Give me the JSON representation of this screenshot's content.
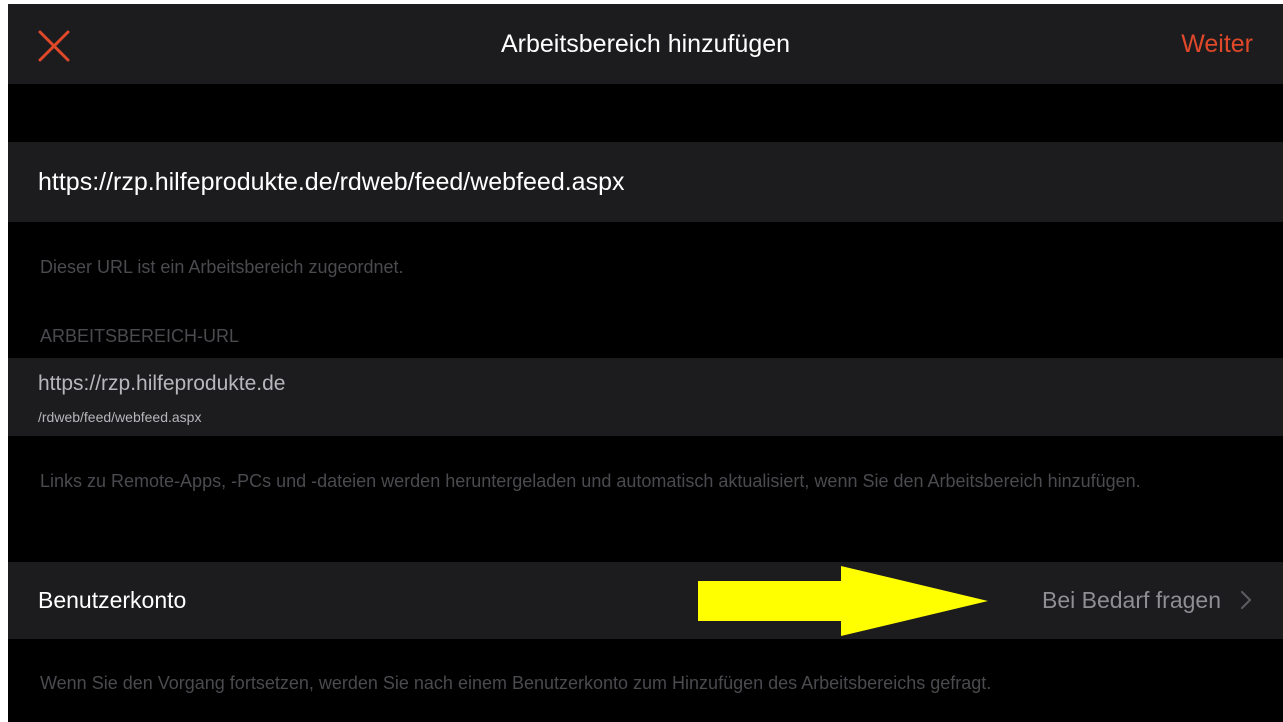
{
  "nav": {
    "title": "Arbeitsbereich hinzufügen",
    "next_label": "Weiter",
    "close_icon": "close-icon",
    "accent_color": "#e0482a"
  },
  "url_field": {
    "value": "https://rzp.hilfeprodukte.de/rdweb/feed/webfeed.aspx"
  },
  "url_footnote": "Dieser URL ist ein Arbeitsbereich zugeordnet.",
  "workspace": {
    "section_header": "ARBEITSBEREICH-URL",
    "url_host": "https://rzp.hilfeprodukte.de",
    "url_path": "/rdweb/feed/webfeed.aspx",
    "footnote": "Links zu Remote-Apps, -PCs und -dateien werden heruntergeladen und automatisch aktualisiert, wenn Sie den Arbeitsbereich hinzufügen."
  },
  "account": {
    "label": "Benutzerkonto",
    "value": "Bei Bedarf fragen",
    "chevron_icon": "chevron-right-icon",
    "footnote": "Wenn Sie den Vorgang fortsetzen, werden Sie nach einem Benutzerkonto zum Hinzufügen des Arbeitsbereichs gefragt."
  },
  "annotation": {
    "arrow_icon": "yellow-arrow-icon",
    "arrow_color": "#ffff00"
  }
}
